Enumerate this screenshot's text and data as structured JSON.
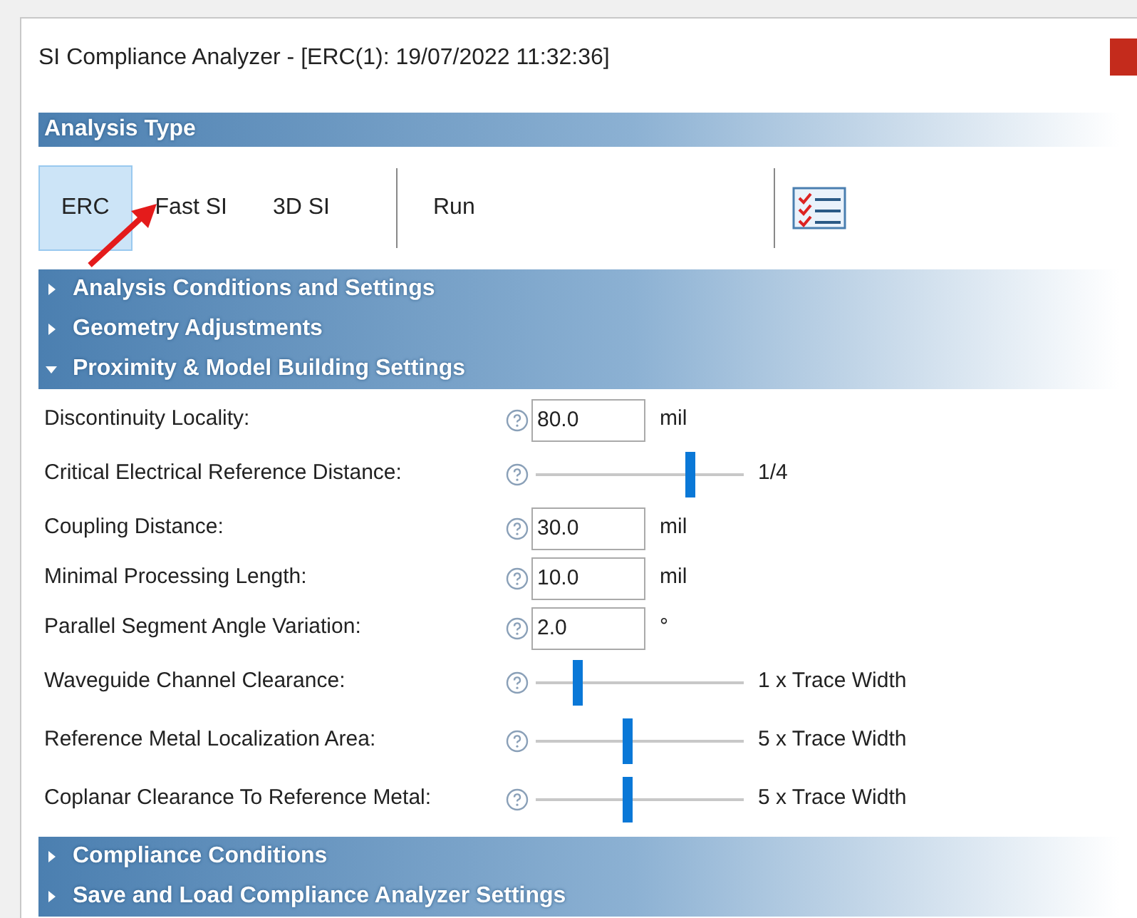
{
  "window": {
    "title": "SI Compliance Analyzer - [ERC(1): 19/07/2022 11:32:36]"
  },
  "analysis_type": {
    "header": "Analysis Type",
    "modes": [
      {
        "label": "ERC",
        "selected": true
      },
      {
        "label": "Fast SI",
        "selected": false
      },
      {
        "label": "3D SI",
        "selected": false
      }
    ],
    "run": "Run"
  },
  "sections": [
    {
      "label": "Analysis Conditions and Settings",
      "expanded": false
    },
    {
      "label": "Geometry Adjustments",
      "expanded": false
    },
    {
      "label": "Proximity & Model Building Settings",
      "expanded": true
    }
  ],
  "settings": [
    {
      "kind": "field",
      "label": "Discontinuity Locality:",
      "value": "80.0",
      "unit": "mil"
    },
    {
      "kind": "slider",
      "label": "Critical Electrical Reference Distance:",
      "level": 0.74,
      "reading": "1/4"
    },
    {
      "kind": "field",
      "label": "Coupling Distance:",
      "value": "30.0",
      "unit": "mil"
    },
    {
      "kind": "field",
      "label": "Minimal Processing Length:",
      "value": "10.0",
      "unit": "mil"
    },
    {
      "kind": "field",
      "label": "Parallel Segment Angle Variation:",
      "value": "2.0",
      "unit": "°"
    },
    {
      "kind": "slider",
      "label": "Waveguide Channel Clearance:",
      "level": 0.2,
      "reading": "1 x Trace Width"
    },
    {
      "kind": "slider",
      "label": "Reference Metal Localization Area:",
      "level": 0.44,
      "reading": "5 x Trace Width"
    },
    {
      "kind": "slider",
      "label": "Coplanar Clearance To Reference Metal:",
      "level": 0.44,
      "reading": "5 x Trace Width"
    }
  ],
  "bottom_sections": [
    {
      "label": "Compliance Conditions",
      "expanded": false
    },
    {
      "label": "Save and Load Compliance Analyzer Settings",
      "expanded": false
    }
  ]
}
